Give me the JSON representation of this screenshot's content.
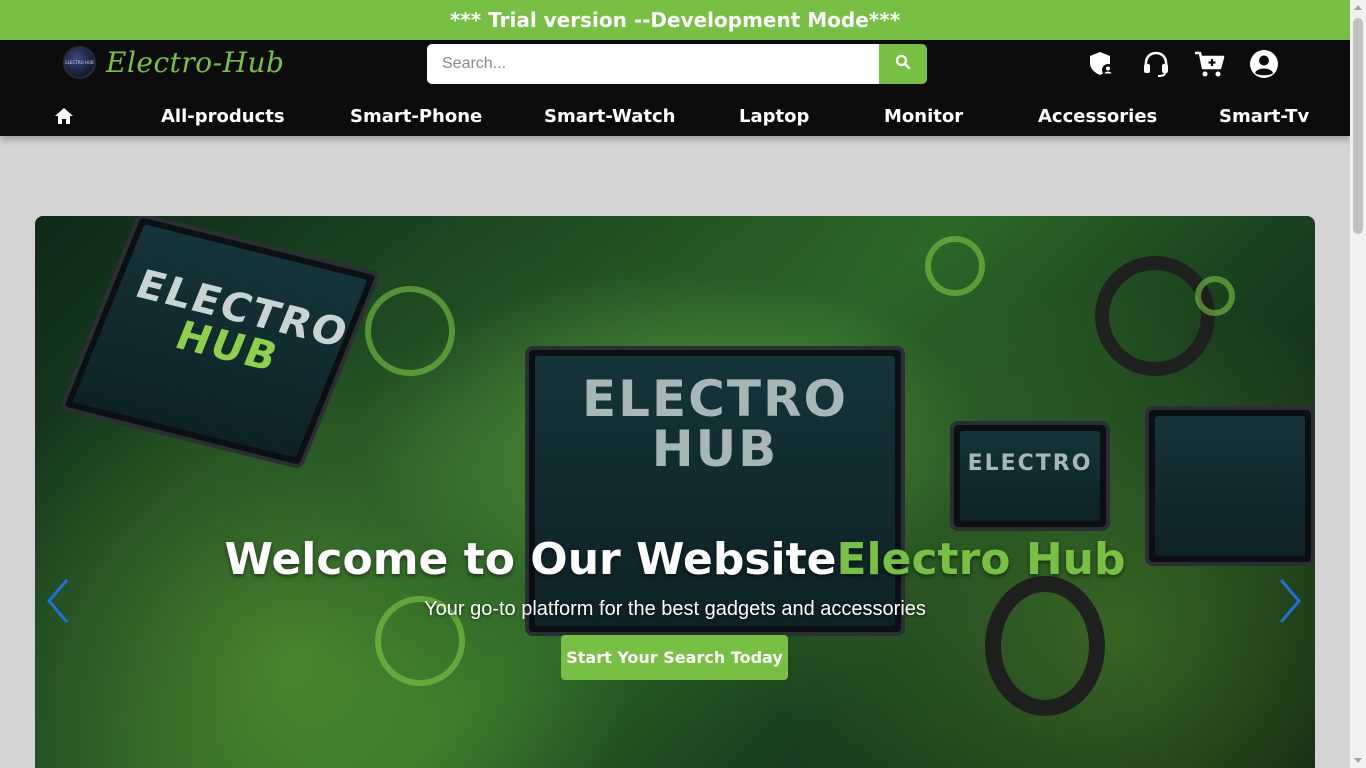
{
  "trial_banner": "*** Trial version --Development Mode***",
  "logo": {
    "text": "Electro-Hub",
    "badge_text": "ELECTRO HUB"
  },
  "search": {
    "placeholder": "Search...",
    "icon": "search-icon"
  },
  "header_icons": [
    "shield-user-icon",
    "headset-icon",
    "cart-plus-icon",
    "user-circle-icon"
  ],
  "nav": {
    "home_icon": "home-icon",
    "items": [
      "All-products",
      "Smart-Phone",
      "Smart-Watch",
      "Laptop",
      "Monitor",
      "Accessories",
      "Smart-Tv"
    ]
  },
  "hero": {
    "title_main": "Welcome to Our Website",
    "title_accent": "Electro Hub",
    "subtitle": "Your go-to platform for the best gadgets and accessories",
    "cta": "Start Your Search Today",
    "image_text": {
      "center_line1": "ELECTRO",
      "center_line2": "HUB",
      "left_line1": "ELECTRO",
      "left_line2": "HUB",
      "right": "ELECTRO"
    }
  },
  "colors": {
    "accent": "#78c043",
    "header_bg": "#0c0c0c",
    "page_bg": "#d4d4d4"
  }
}
